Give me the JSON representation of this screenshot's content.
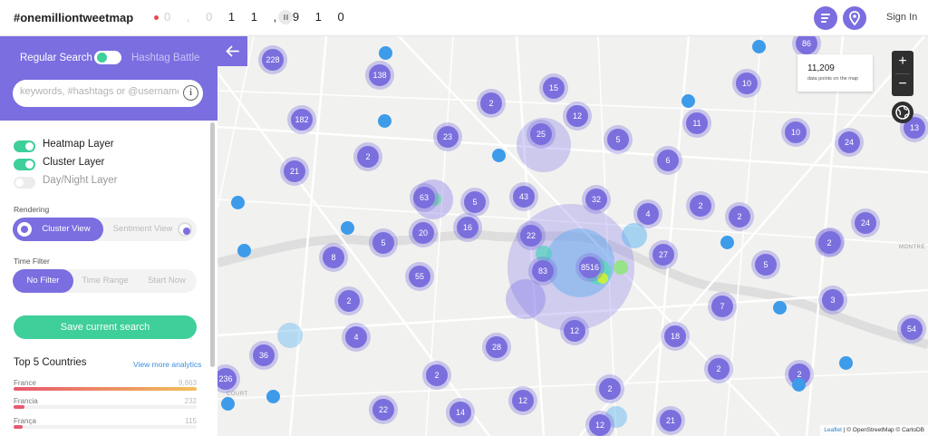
{
  "colors": {
    "accent": "#7a6ee0",
    "cluster": "#7b6fde",
    "green": "#3ecf9a",
    "pin": "#3d9be9",
    "live": "#e44b4b"
  },
  "header": {
    "brand": "#onemilliontweetmap",
    "counter_dim": "0 , 0",
    "counter_digits": "1 1 , 9 1 0",
    "signin": "Sign In",
    "icons": [
      "list-icon",
      "location-pin-icon",
      "pause-icon"
    ]
  },
  "sidebar": {
    "mode_regular": "Regular Search",
    "mode_hashtag": "Hashtag Battle",
    "search_placeholder": "keywords, #hashtags or @username",
    "layers": [
      {
        "label": "Heatmap Layer",
        "on": true
      },
      {
        "label": "Cluster Layer",
        "on": true
      },
      {
        "label": "Day/Night Layer",
        "on": false
      }
    ],
    "rendering_label": "Rendering",
    "rendering_options": [
      "Cluster View",
      "Sentiment View"
    ],
    "time_filter_label": "Time Filter",
    "time_options": [
      "No Filter",
      "Time Range",
      "Start Now"
    ],
    "save_label": "Save current search",
    "top_title": "Top 5 Countries",
    "analytics_link": "View more analytics",
    "countries": [
      {
        "name": "France",
        "value": "9,863",
        "fraction": 1.0
      },
      {
        "name": "Francia",
        "value": "232",
        "fraction": 0.06
      },
      {
        "name": "França",
        "value": "115",
        "fraction": 0.05
      }
    ]
  },
  "map": {
    "count_value": "11,209",
    "count_sub": "data points on the map",
    "zoom_in": "+",
    "zoom_out": "−",
    "labels": [
      "MONTRE",
      "COURT"
    ],
    "attribution_leaflet": "Leaflet",
    "attribution_rest": " | © OpenStreetMap © CartoDB",
    "clusters": [
      "228",
      "138",
      "182",
      "86",
      "10",
      "15",
      "2",
      "12",
      "11",
      "10",
      "23",
      "25",
      "5",
      "24",
      "2",
      "21",
      "6",
      "13",
      "2",
      "63",
      "5",
      "43",
      "32",
      "4",
      "2",
      "2",
      "24",
      "20",
      "16",
      "22",
      "5",
      "8",
      "55",
      "83",
      "8516",
      "27",
      "2",
      "5",
      "2",
      "4",
      "2",
      "3",
      "7",
      "54",
      "12",
      "18",
      "36",
      "28",
      "2",
      "236",
      "2",
      "2",
      "12",
      "22",
      "14",
      "12",
      "21"
    ]
  }
}
